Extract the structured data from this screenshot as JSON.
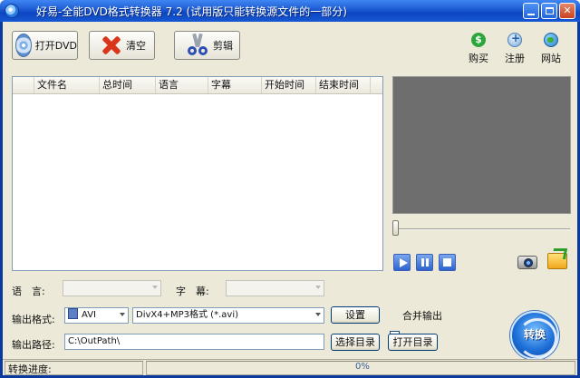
{
  "window": {
    "title": "好易-全能DVD格式转换器 7.2 (试用版只能转换源文件的一部分)"
  },
  "toolbar": {
    "open_dvd_label": "打开DVD",
    "clear_label": "清空",
    "cut_label": "剪辑"
  },
  "top_links": {
    "buy_label": "购买",
    "register_label": "注册",
    "website_label": "网站"
  },
  "file_list": {
    "columns": [
      "文件名",
      "总时间",
      "语言",
      "字幕",
      "开始时间",
      "结束时间"
    ],
    "rows": []
  },
  "playback": {
    "play_icon": "play-icon",
    "pause_icon": "pause-icon",
    "stop_icon": "stop-icon",
    "position_fraction": 0
  },
  "language": {
    "label": "语　言:",
    "value": ""
  },
  "subtitle": {
    "label": "字　幕:",
    "value": ""
  },
  "output_format": {
    "label": "输出格式:",
    "container_value": "AVI",
    "codec_value": "DivX4+MP3格式 (*.avi)",
    "settings_label": "设置",
    "merge_label": "合并输出",
    "merge_checked": false
  },
  "output_path": {
    "label": "输出路径:",
    "value": "C:\\OutPath\\",
    "choose_dir_label": "选择目录",
    "open_dir_label": "打开目录"
  },
  "convert": {
    "label": "转换"
  },
  "status": {
    "progress_label": "转换进度:",
    "progress_value": "0%"
  },
  "colors": {
    "titlebar": "#1f5fd6",
    "window_bg": "#ece9d8",
    "preview_bg": "#6e6e6e",
    "convert_button": "#1d6fd8"
  }
}
